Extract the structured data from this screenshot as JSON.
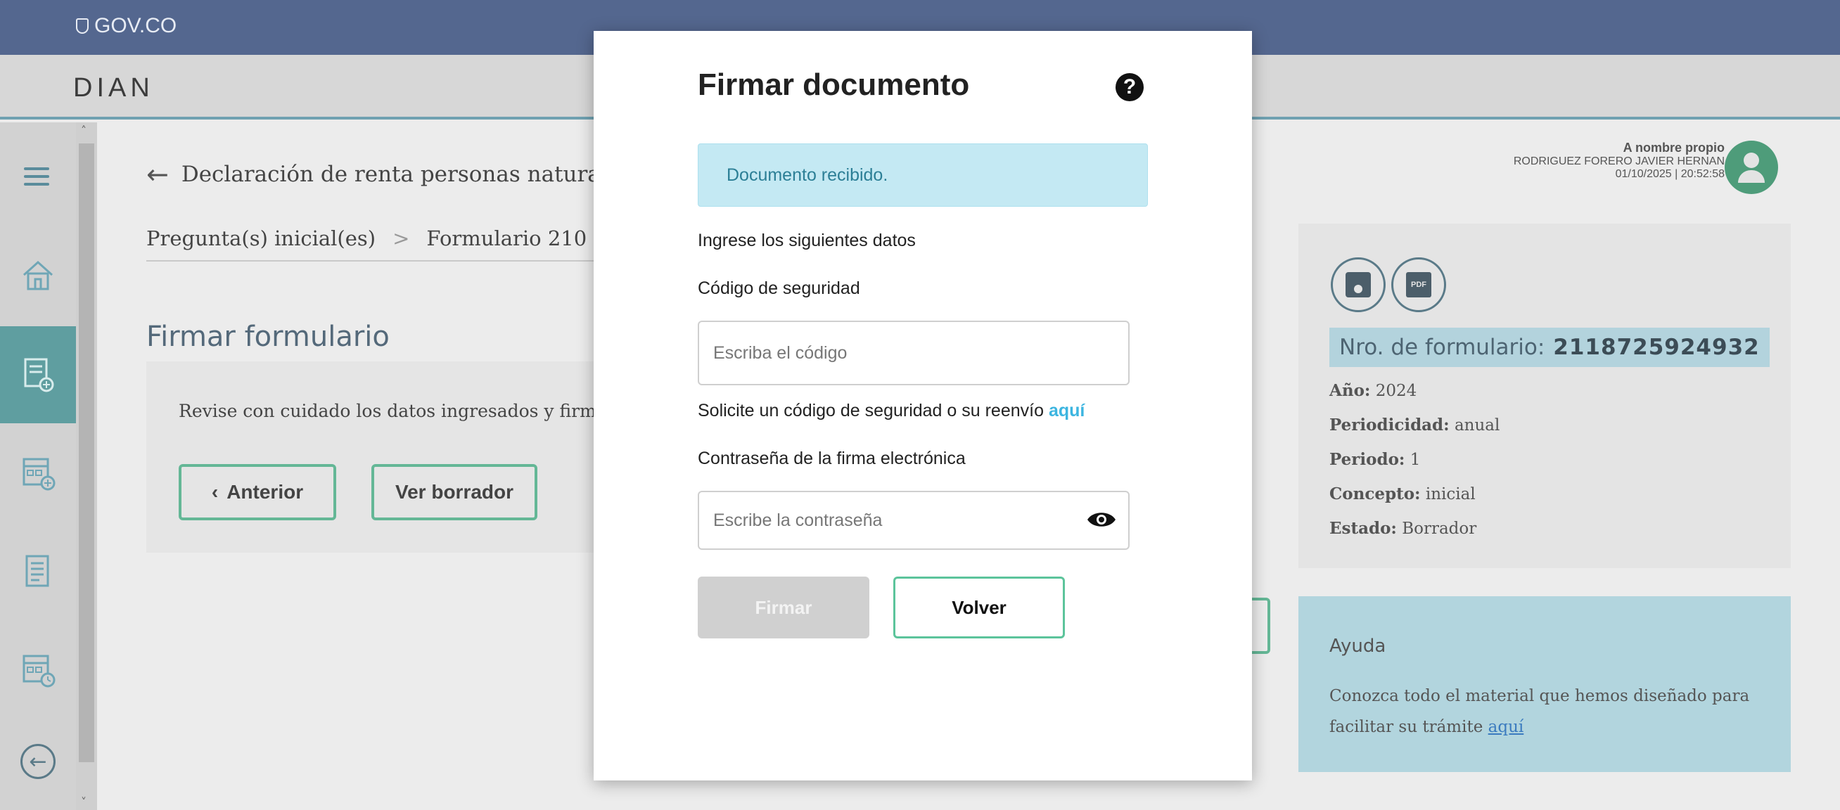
{
  "gov_bar": {
    "logo_text": "GOV.CO"
  },
  "dian_bar": {
    "brand": "DIAN"
  },
  "sidebar": {
    "items": [
      {
        "name": "menu",
        "icon": "hamburger-icon"
      },
      {
        "name": "home",
        "icon": "home-icon"
      },
      {
        "name": "form",
        "icon": "form-add-icon",
        "active": true
      },
      {
        "name": "calendar-add",
        "icon": "calendar-add-icon"
      },
      {
        "name": "document",
        "icon": "document-icon"
      },
      {
        "name": "calendar-clock",
        "icon": "calendar-clock-icon"
      },
      {
        "name": "logout",
        "icon": "circle-arrow-left-icon"
      }
    ]
  },
  "main": {
    "title": "Declaración de renta personas naturales /",
    "steps": [
      "Pregunta(s) inicial(es)",
      "Formulario 210"
    ],
    "step_separator": ">",
    "section_title": "Firmar formulario",
    "hint": "Revise con cuidado los datos ingresados y firme.",
    "buttons": {
      "anterior": "Anterior",
      "ver_borrador": "Ver borrador"
    }
  },
  "user": {
    "role": "A nombre propio",
    "name": "RODRIGUEZ FORERO JAVIER HERNAN",
    "datetime": "01/10/2025 | 20:52:58"
  },
  "form_info": {
    "form_number_label": "Nro. de formulario:",
    "form_number": "2118725924932",
    "fields": [
      {
        "label": "Año:",
        "value": "2024"
      },
      {
        "label": "Periodicidad:",
        "value": "anual"
      },
      {
        "label": "Periodo:",
        "value": "1"
      },
      {
        "label": "Concepto:",
        "value": "inicial"
      },
      {
        "label": "Estado:",
        "value": "Borrador"
      }
    ],
    "pdf_label": "PDF"
  },
  "help": {
    "title": "Ayuda",
    "text": "Conozca todo el material que hemos diseñado para facilitar su trámite",
    "link": "aquí"
  },
  "modal": {
    "title": "Firmar documento",
    "help_icon": "?",
    "alert": "Documento recibido.",
    "instructions": "Ingrese los siguientes datos",
    "code_label": "Código de seguridad",
    "code_placeholder": "Escriba el código",
    "resend_text": "Solicite un código de seguridad o su reenvío",
    "resend_link": "aquí",
    "password_label": "Contraseña de la firma electrónica",
    "password_placeholder": "Escribe la contraseña",
    "sign_button": "Firmar",
    "back_button": "Volver"
  },
  "colors": {
    "gov_bar": "#54678f",
    "accent_green": "#5cc49b",
    "alert_bg": "#c4e9f3",
    "link": "#3cb5e0",
    "sidebar_active": "#5f9ea0"
  }
}
